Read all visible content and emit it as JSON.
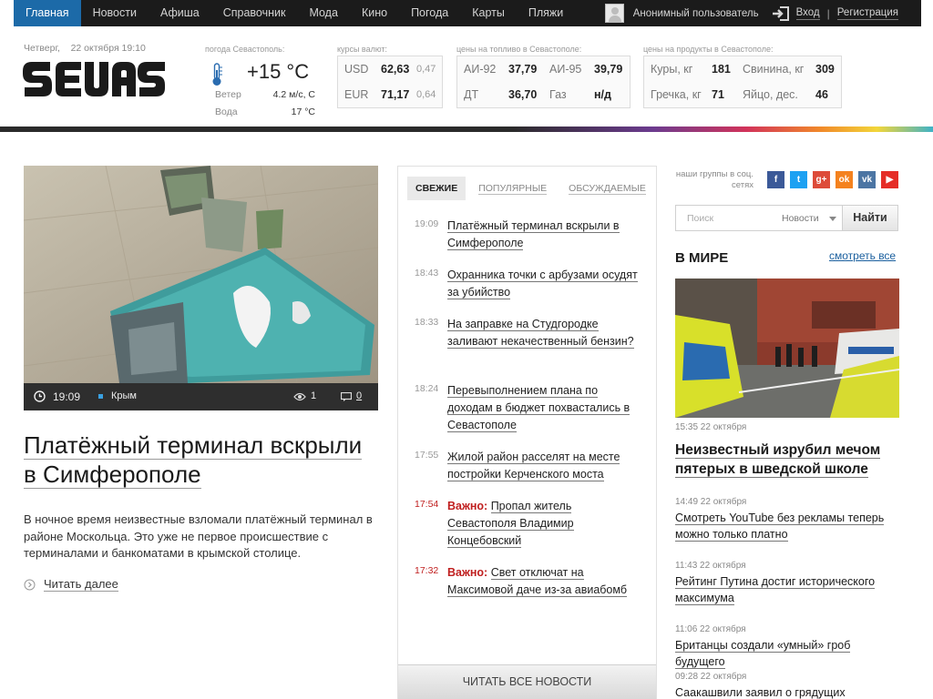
{
  "nav": {
    "items": [
      "Главная",
      "Новости",
      "Афиша",
      "Справочник",
      "Мода",
      "Кино",
      "Погода",
      "Карты",
      "Пляжи"
    ],
    "user": "Анонимный пользователь",
    "login": "Вход",
    "sep": "|",
    "register": "Регистрация"
  },
  "header": {
    "date": "Четверг,    22 октября 19:10",
    "weather": {
      "caption": "погода Севастополь:",
      "temp": "+15 °C",
      "wind_label": "Ветер",
      "wind_value": "4.2 м/с, С",
      "water_label": "Вода",
      "water_value": "17 °C"
    },
    "currency": {
      "caption": "курсы валют:",
      "rows": [
        {
          "code": "USD",
          "value": "62,63",
          "change": "0,47"
        },
        {
          "code": "EUR",
          "value": "71,17",
          "change": "0,64"
        }
      ]
    },
    "fuel": {
      "caption": "цены на топливо в Севастополе:",
      "rows": [
        {
          "name1": "АИ-92",
          "value1": "37,79",
          "name2": "АИ-95",
          "value2": "39,79"
        },
        {
          "name1": "ДТ",
          "value1": "36,70",
          "name2": "Газ",
          "value2": "н/д"
        }
      ]
    },
    "products": {
      "caption": "цены на продукты в Севастополе:",
      "rows": [
        {
          "name1": "Куры, кг",
          "value1": "181",
          "name2": "Свинина, кг",
          "value2": "309"
        },
        {
          "name1": "Гречка, кг",
          "value1": "71",
          "name2": "Яйцо, дес.",
          "value2": "46"
        }
      ]
    }
  },
  "main_story": {
    "time": "19:09",
    "tag": "Крым",
    "views": "1",
    "comments": "0",
    "title": "Платёжный терминал вскрыли в Симферополе",
    "lead": "В ночное время неизвестные взломали платёжный терминал в районе Москольца. Это уже не первое происшествие с терминалами и банкоматами в крымской столице.",
    "read_more": "Читать далее"
  },
  "feed": {
    "tabs": [
      "Свежие",
      "Популярные",
      "Обсуждаемые"
    ],
    "items": [
      {
        "time": "19:09",
        "important": "",
        "title": "Платёжный терминал вскрыли в Симферополе"
      },
      {
        "time": "18:43",
        "important": "",
        "title": "Охранника точки с арбузами осудят за убийство"
      },
      {
        "time": "18:33",
        "important": "",
        "title": "На заправке на Студгородке заливают некачественный бензин?"
      },
      {
        "time": "18:24",
        "important": "",
        "title": "Перевыполнением плана по доходам в бюджет похвастались в Севастополе"
      },
      {
        "time": "17:55",
        "important": "",
        "title": "Жилой район расселят на месте постройки Керченского моста"
      },
      {
        "time": "17:54",
        "important": "Важно:",
        "title": "Пропал житель Севастополя Владимир Концебовский"
      },
      {
        "time": "17:32",
        "important": "Важно:",
        "title": "Свет отключат на Максимовой даче из-за авиабомб"
      }
    ],
    "read_all": "Читать все новости"
  },
  "sidebar": {
    "social_caption": "наши группы в соц. сетях",
    "social": [
      {
        "icon": "facebook-icon",
        "glyph": "f",
        "color": "#3b5998"
      },
      {
        "icon": "twitter-icon",
        "glyph": "t",
        "color": "#1da1f2"
      },
      {
        "icon": "googleplus-icon",
        "glyph": "g+",
        "color": "#dd4b39"
      },
      {
        "icon": "odnoklassniki-icon",
        "glyph": "ok",
        "color": "#f4821f"
      },
      {
        "icon": "vk-icon",
        "glyph": "vk",
        "color": "#4c75a3"
      },
      {
        "icon": "youtube-icon",
        "glyph": "▶",
        "color": "#e52d27"
      }
    ],
    "search": {
      "placeholder": "Поиск",
      "scope": "Новости",
      "button": "Найти"
    },
    "world": {
      "title": "В МИРЕ",
      "see_all": "смотреть все",
      "items": [
        {
          "time": "15:35 22 октября",
          "title": "Неизвестный изрубил мечом пятерых в шведской школе"
        },
        {
          "time": "14:49 22 октября",
          "title": "Смотреть YouTube без рекламы теперь можно только платно"
        },
        {
          "time": "11:43 22 октября",
          "title": "Рейтинг Путина достиг исторического максимума"
        },
        {
          "time": "11:06 22 октября",
          "title": "Британцы создали «умный» гроб будущего"
        },
        {
          "time": "09:28 22 октября",
          "title": "Саакашвили заявил о грядущих"
        }
      ]
    }
  }
}
